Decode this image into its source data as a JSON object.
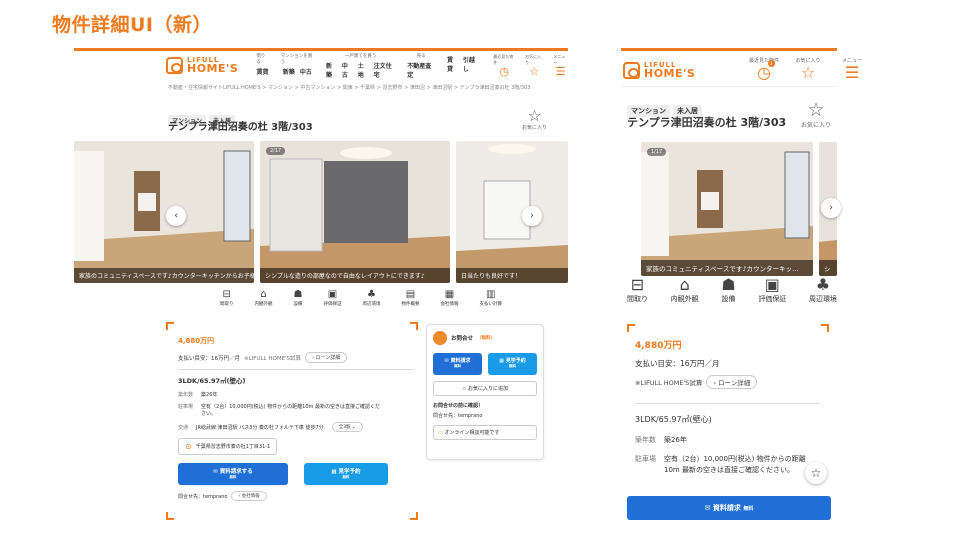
{
  "slide_title": "物件詳細UI（新）",
  "colors": {
    "brand": "#ef7a1f",
    "primary": "#1f6fd6",
    "secondary": "#1a9be8",
    "price": "#ef7a1f"
  },
  "desktop": {
    "logo": {
      "line1": "LIFULL",
      "line2": "HOME'S"
    },
    "nav": [
      {
        "group": "借りる",
        "items": [
          "賃貸"
        ]
      },
      {
        "group": "マンションを買う",
        "items": [
          "新築",
          "中古"
        ]
      },
      {
        "group": "一戸建てを買う",
        "items": [
          "新築",
          "中古",
          "土地",
          "注文住宅"
        ]
      },
      {
        "group": "売る",
        "items": [
          "不動産査定"
        ]
      },
      {
        "group": "",
        "items": [
          "賃貸",
          "引越し"
        ]
      }
    ],
    "header_icons": [
      {
        "label": "最近見た物件",
        "icon": "clock-icon"
      },
      {
        "label": "お気に入り",
        "icon": "star-icon"
      },
      {
        "label": "メニュー",
        "icon": "menu-icon"
      }
    ],
    "breadcrumb": "不動産・住宅情報サイトLIFULL HOME'S > マンション > 中古マンション > 関東 > 千葉県 > 習志野市 > 津田沼 > 津田沼駅 > テンプラ津田沼奏の杜 3階/303",
    "tags": [
      "マンション",
      "未入居"
    ],
    "title": "テンプラ津田沼奏の杜 3階/303",
    "favorite_label": "お気に入り",
    "photos": [
      {
        "caption": "家族のコミュニティスペースです♪カウンターキッチンからお子様の様子も見れるので…",
        "counter": ""
      },
      {
        "caption": "シンプルな造りの部屋なので自由なレイアウトにできます♪",
        "counter": "2/17"
      },
      {
        "caption": "日当たりも良好です！",
        "counter": ""
      }
    ],
    "icon_bar": [
      "間取り",
      "内観外観",
      "設備",
      "評価保証",
      "周辺環境",
      "物件概要",
      "会社情報",
      "支払い計算"
    ],
    "price": "4,880万円",
    "monthly": "支払い目安：16万円／月",
    "monthly_note": "※LIFULL HOME'S試算",
    "loan_label": "ローン詳細",
    "spec": "3LDK/65.97㎡(壁心)",
    "age_label": "築年数",
    "age_value": "築26年",
    "parking_label": "駐車場",
    "parking_value": "空有（2台）10,000円(税込) 物件からの距離10m 最新の空きは直接ご確認ください。",
    "access_label": "交通",
    "access_value": "JR総武線 津田沼駅 バス3分 奏の杜フォルテ下車 徒歩7分",
    "access_more": "全3駅",
    "address": "千葉県習志野市奏の杜1丁目31-1",
    "cta_request": "資料請求する",
    "cta_visit": "見学予約",
    "free": "無料",
    "inquiry_to": "問合せ先：temprano",
    "company_info": "会社情報",
    "side": {
      "title": "お問合せ",
      "free": "（無料）",
      "btn_request": "資料請求",
      "btn_visit": "見学予約",
      "add_fav": "お気に入りに追加",
      "check": "お問合せの前に確認！",
      "contact": "問合せ先：temprano",
      "online": "オンライン相談可能です"
    }
  },
  "mobile": {
    "logo": {
      "line1": "LIFULL",
      "line2": "HOME'S"
    },
    "header_icons": [
      {
        "label": "最近見た物件",
        "icon": "clock-icon",
        "badge": "3"
      },
      {
        "label": "お気に入り",
        "icon": "star-icon"
      },
      {
        "label": "メニュー",
        "icon": "menu-icon"
      }
    ],
    "tags": [
      "マンション",
      "未入居"
    ],
    "title": "テンプラ津田沼奏の杜 3階/303",
    "favorite_label": "お気に入り",
    "photo_caption": "家族のコミュニティスペースです♪カウンターキッ…",
    "photo_caption2": "シ",
    "photo_counter": "1/17",
    "icon_bar": [
      "間取り",
      "内観外観",
      "設備",
      "評価保証",
      "周辺環境"
    ],
    "price": "4,880万円",
    "monthly": "支払い目安：16万円／月",
    "monthly_note": "※LIFULL HOME'S試算",
    "loan_label": "ローン詳細",
    "spec": "3LDK/65.97㎡(壁心)",
    "age_label": "築年数",
    "age_value": "築26年",
    "parking_label": "駐車場",
    "parking_value": "空有（2台）10,000円(税込) 物件からの距離10m 最新の空きは直接ご確認ください。",
    "cta_request": "資料請求",
    "free": "無料"
  }
}
